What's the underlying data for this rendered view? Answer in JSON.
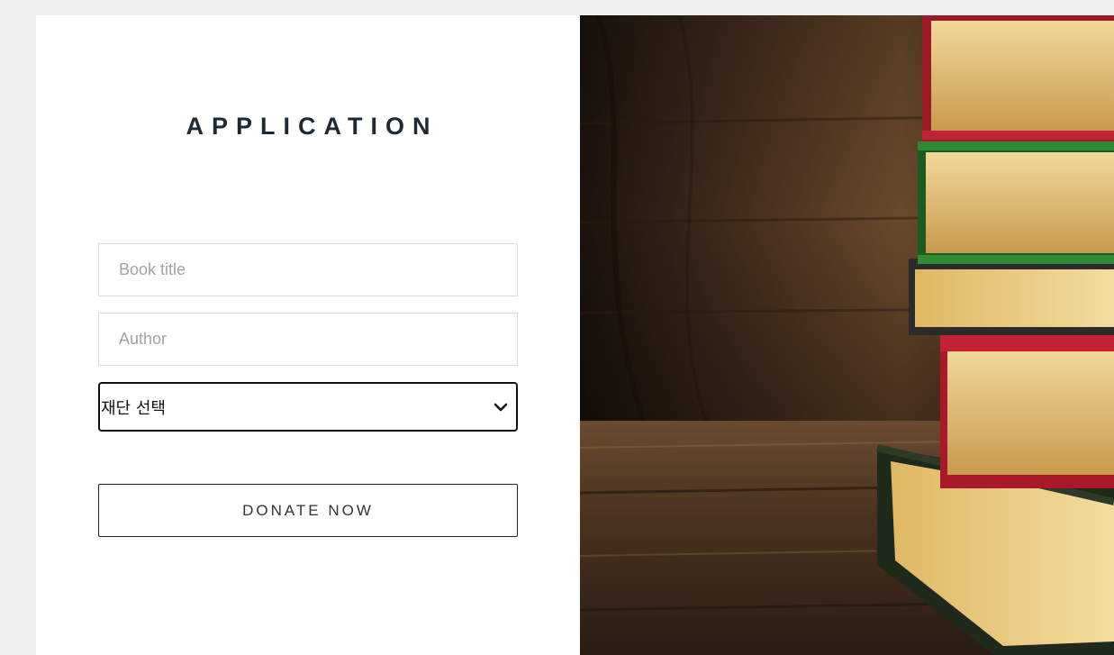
{
  "form": {
    "title": "APPLICATION",
    "book_title_placeholder": "Book title",
    "author_placeholder": "Author",
    "foundation_select_value": "재단 선택",
    "donate_label": "DONATE NOW"
  },
  "hero_image": {
    "subject": "stack of old books on wooden table"
  }
}
